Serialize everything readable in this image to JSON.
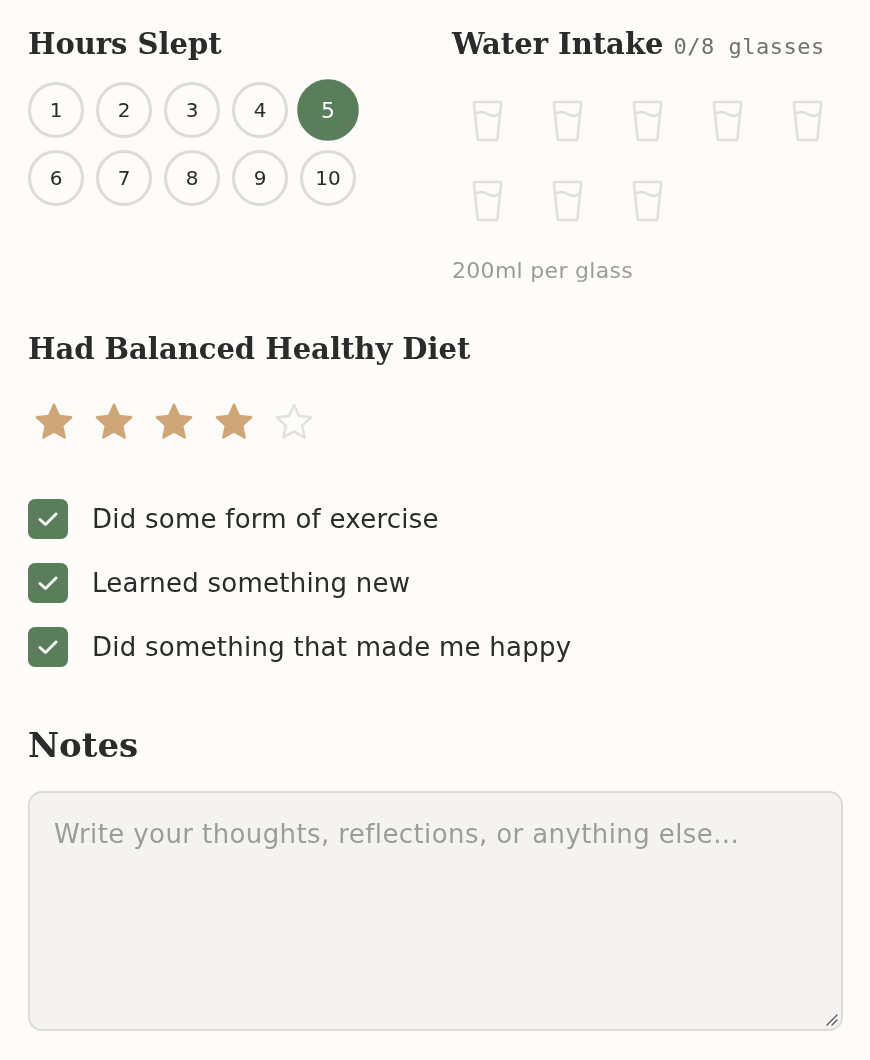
{
  "sleep": {
    "title": "Hours Slept",
    "options": [
      {
        "label": "1",
        "selected": false
      },
      {
        "label": "2",
        "selected": false
      },
      {
        "label": "3",
        "selected": false
      },
      {
        "label": "4",
        "selected": false
      },
      {
        "label": "5",
        "selected": true
      },
      {
        "label": "6",
        "selected": false
      },
      {
        "label": "7",
        "selected": false
      },
      {
        "label": "8",
        "selected": false
      },
      {
        "label": "9",
        "selected": false
      },
      {
        "label": "10",
        "selected": false
      }
    ]
  },
  "water": {
    "title": "Water Intake",
    "count": "0/8 glasses",
    "glasses": [
      {
        "filled": false
      },
      {
        "filled": false
      },
      {
        "filled": false
      },
      {
        "filled": false
      },
      {
        "filled": false
      },
      {
        "filled": false
      },
      {
        "filled": false
      },
      {
        "filled": false
      }
    ],
    "note": "200ml per glass"
  },
  "diet": {
    "title": "Had Balanced Healthy Diet",
    "stars": 4
  },
  "habits": [
    {
      "label": "Did some form of exercise",
      "checked": true
    },
    {
      "label": "Learned something new",
      "checked": true
    },
    {
      "label": "Did something that made me happy",
      "checked": true
    }
  ],
  "notes": {
    "title": "Notes",
    "placeholder": "Write your thoughts, reflections, or anything else..."
  }
}
